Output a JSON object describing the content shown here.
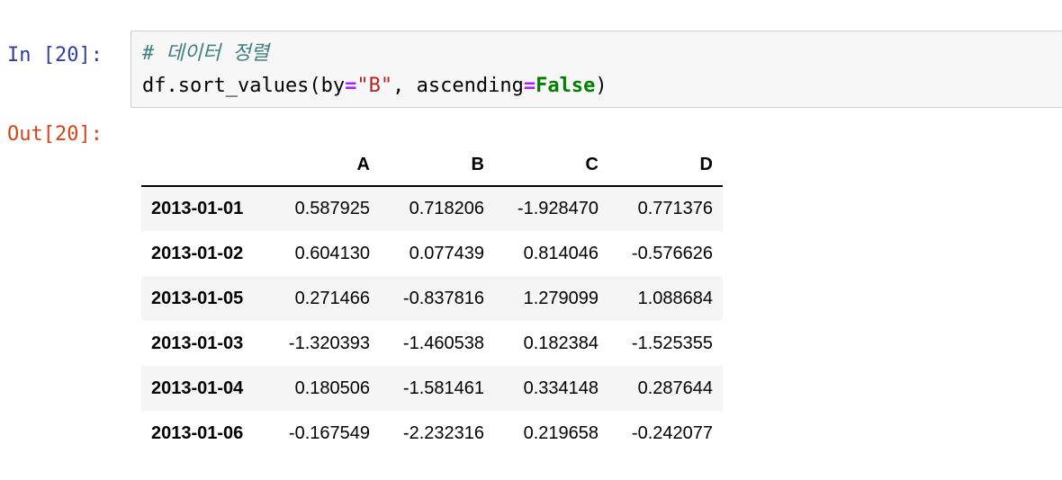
{
  "input_prompt": "In [20]:",
  "output_prompt": "Out[20]:",
  "code": {
    "comment": "# 데이터 정렬",
    "line2": {
      "call_open": "df.sort_values(by",
      "eq1": "=",
      "str_val": "\"B\"",
      "middle": ", ascending",
      "eq2": "=",
      "kw_val": "False",
      "close": ")"
    }
  },
  "table": {
    "index_header": "",
    "columns": [
      "A",
      "B",
      "C",
      "D"
    ],
    "rows": [
      {
        "index": "2013-01-01",
        "values": [
          "0.587925",
          "0.718206",
          "-1.928470",
          "0.771376"
        ]
      },
      {
        "index": "2013-01-02",
        "values": [
          "0.604130",
          "0.077439",
          "0.814046",
          "-0.576626"
        ]
      },
      {
        "index": "2013-01-05",
        "values": [
          "0.271466",
          "-0.837816",
          "1.279099",
          "1.088684"
        ]
      },
      {
        "index": "2013-01-03",
        "values": [
          "-1.320393",
          "-1.460538",
          "0.182384",
          "-1.525355"
        ]
      },
      {
        "index": "2013-01-04",
        "values": [
          "0.180506",
          "-1.581461",
          "0.334148",
          "0.287644"
        ]
      },
      {
        "index": "2013-01-06",
        "values": [
          "-0.167549",
          "-2.232316",
          "0.219658",
          "-0.242077"
        ]
      }
    ]
  }
}
